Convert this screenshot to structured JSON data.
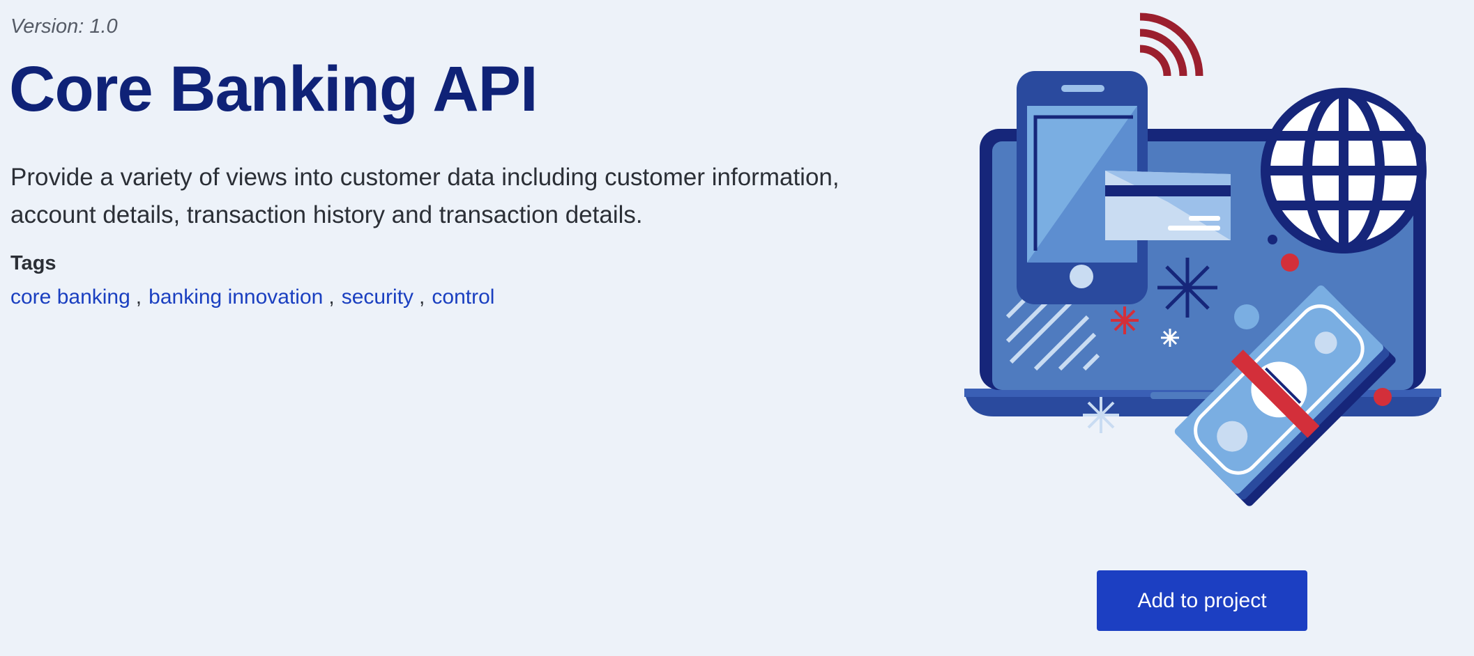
{
  "api": {
    "version_label": "Version: 1.0",
    "title": "Core Banking API",
    "description": "Provide a variety of views into customer data including customer information, account details, transaction history and transaction details."
  },
  "tags": {
    "heading": "Tags",
    "separator": ",",
    "items": [
      "core banking",
      "banking innovation",
      "security",
      "control"
    ]
  },
  "actions": {
    "add_to_project_label": "Add to project"
  },
  "illustration": {
    "icon_name": "banking-illustration",
    "colors": {
      "navy": "#16267a",
      "blue": "#4f7bbf",
      "light_blue": "#7aaee2",
      "pale_blue": "#c9dcf2",
      "red": "#d32f3a",
      "dark_red": "#9b1f2e"
    }
  },
  "theme": {
    "background": "#edf2f9",
    "title_color": "#0f2277",
    "link_color": "#1a3fc0",
    "button_color": "#1c3fc2"
  }
}
